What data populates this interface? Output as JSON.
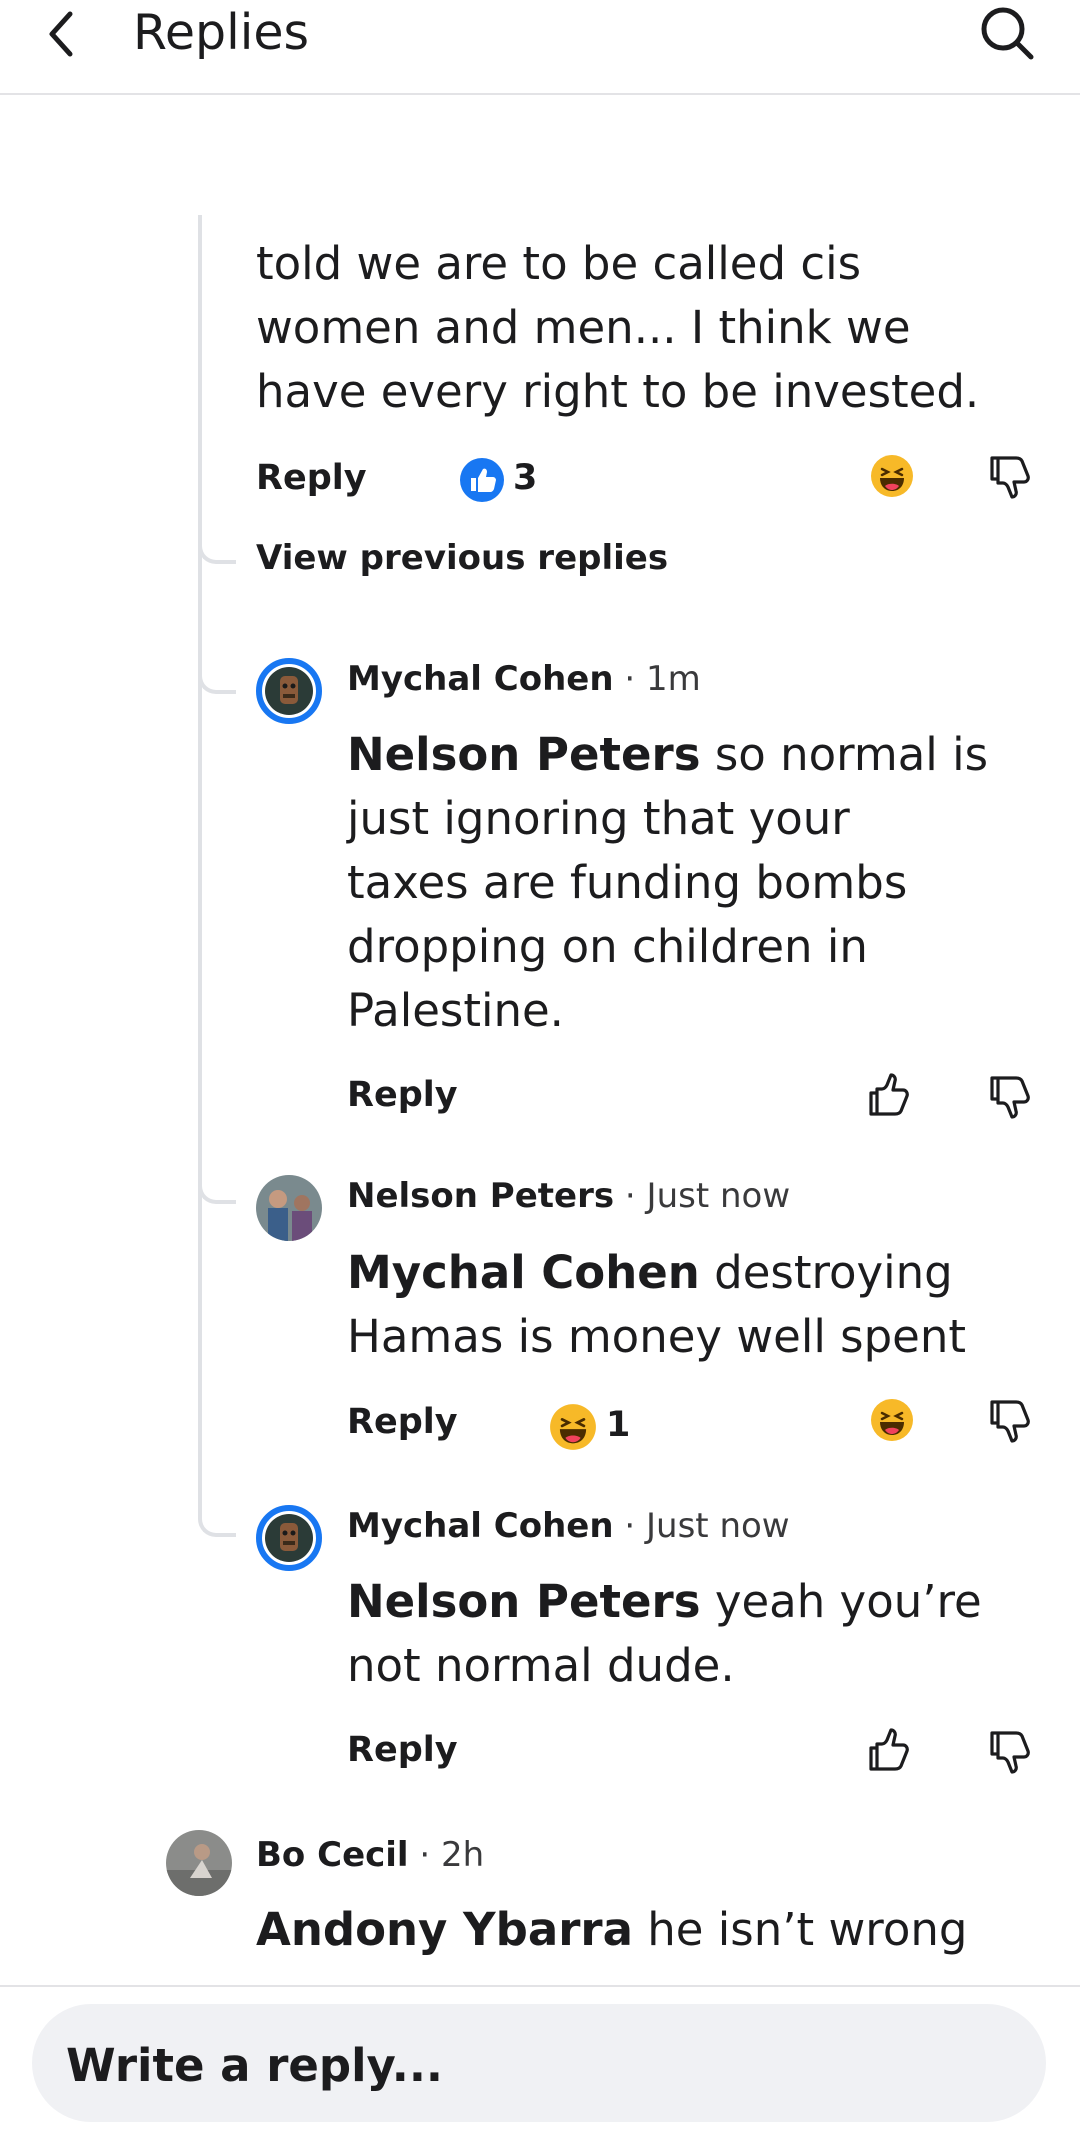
{
  "header": {
    "title": "Replies"
  },
  "comments": [
    {
      "text_lines": [
        "told we are to be called cis",
        "women and men... I think we",
        "have every right to be invested."
      ],
      "reply_label": "Reply",
      "like_count": "3"
    },
    {
      "author": "Mychal Cohen",
      "time": "1m",
      "mention": "Nelson Peters",
      "text": " so normal is just ignoring that your taxes are funding bombs dropping on children in Palestine.",
      "text_lines": [
        "so normal is",
        "just ignoring that your",
        "taxes are funding bombs",
        "dropping on children in",
        "Palestine."
      ],
      "reply_label": "Reply"
    },
    {
      "author": "Nelson Peters",
      "time": "Just now",
      "mention": "Mychal Cohen",
      "text_lines": [
        "destroying",
        "Hamas is money well spent"
      ],
      "reply_label": "Reply",
      "reaction_count": "1"
    },
    {
      "author": "Mychal Cohen",
      "time": "Just now",
      "mention": "Nelson Peters",
      "text_lines": [
        "yeah you’re",
        "not normal dude."
      ],
      "reply_label": "Reply"
    },
    {
      "author": "Bo Cecil",
      "time": "2h",
      "mention": "Andony Ybarra",
      "text_lines": [
        "he isn’t wrong"
      ]
    }
  ],
  "view_previous_label": "View previous replies",
  "separator": "·",
  "composer": {
    "placeholder": "Write a reply..."
  },
  "colors": {
    "like_blue": "#1877f2",
    "haha_yellow": "#f7b928",
    "ring_blue": "#1877f2"
  }
}
